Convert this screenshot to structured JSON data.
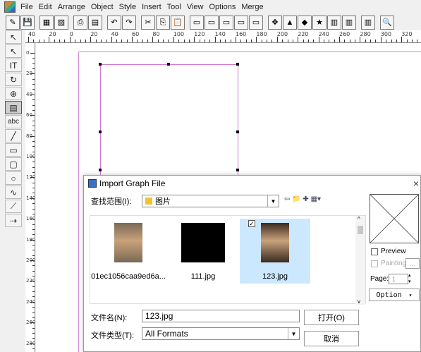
{
  "menu": [
    "File",
    "Edit",
    "Arrange",
    "Object",
    "Style",
    "Insert",
    "Tool",
    "View",
    "Options",
    "Merge"
  ],
  "toolbar_icons": [
    "new-icon",
    "save-icon",
    "tool3-icon",
    "tool4-icon",
    "print-icon",
    "tool6-icon",
    "undo-icon",
    "redo-icon",
    "cut-icon",
    "copy-icon",
    "paste-icon",
    "tool12-icon",
    "tool13-icon",
    "tool14-icon",
    "tool15-icon",
    "tool16-icon",
    "align-icon",
    "chart-icon",
    "color-icon",
    "star-icon",
    "tool21-icon",
    "tool22-icon",
    "tool23-icon",
    "zoom-icon"
  ],
  "ruler_h_labels": [
    "40",
    "20",
    "0",
    "20",
    "40",
    "60",
    "80",
    "100",
    "120",
    "140",
    "160",
    "180",
    "200",
    "220",
    "240",
    "260",
    "280",
    "300",
    "320"
  ],
  "ruler_v_labels": [
    "0",
    "20",
    "40",
    "60",
    "80",
    "100",
    "120",
    "140",
    "160",
    "180",
    "200",
    "220",
    "240",
    "260",
    "280"
  ],
  "tools": [
    {
      "name": "arrow-tool",
      "glyph": "↖"
    },
    {
      "name": "subselect-tool",
      "glyph": "↖"
    },
    {
      "name": "text-tool",
      "glyph": "IT"
    },
    {
      "name": "rotate-tool",
      "glyph": "↻"
    },
    {
      "name": "zoom-tool",
      "glyph": "⊕"
    },
    {
      "name": "fill-tool",
      "glyph": "▤"
    },
    {
      "name": "abc-tool",
      "glyph": "abc"
    },
    {
      "name": "line-tool",
      "glyph": "╱"
    },
    {
      "name": "rect-tool",
      "glyph": "▭"
    },
    {
      "name": "round-rect-tool",
      "glyph": "▢"
    },
    {
      "name": "ellipse-tool",
      "glyph": "○"
    },
    {
      "name": "curve-tool",
      "glyph": "∿"
    },
    {
      "name": "polyline-tool",
      "glyph": "⟋"
    },
    {
      "name": "measure-tool",
      "glyph": "⇢"
    }
  ],
  "dialog": {
    "title": "Import Graph File",
    "close": "×",
    "look_in_label": "查找范围(I):",
    "look_in_value": "图片",
    "files": [
      {
        "name": "01ec1056caa9ed6a...",
        "thumb_color": "#7a6a55",
        "selected": false
      },
      {
        "name": "111.jpg",
        "thumb_color": "#000000",
        "selected": false
      },
      {
        "name": "123.jpg",
        "thumb_color": "#3a2a20",
        "selected": true
      }
    ],
    "preview_label": "Preview",
    "painting_label": "Painting",
    "page_label": "Page:",
    "page_value": "1",
    "option_label": "Option",
    "filename_label": "文件名(N):",
    "filename_value": "123.jpg",
    "filetype_label": "文件类型(T):",
    "filetype_value": "All Formats",
    "open_button": "打开(O)",
    "cancel_button": "取消"
  }
}
